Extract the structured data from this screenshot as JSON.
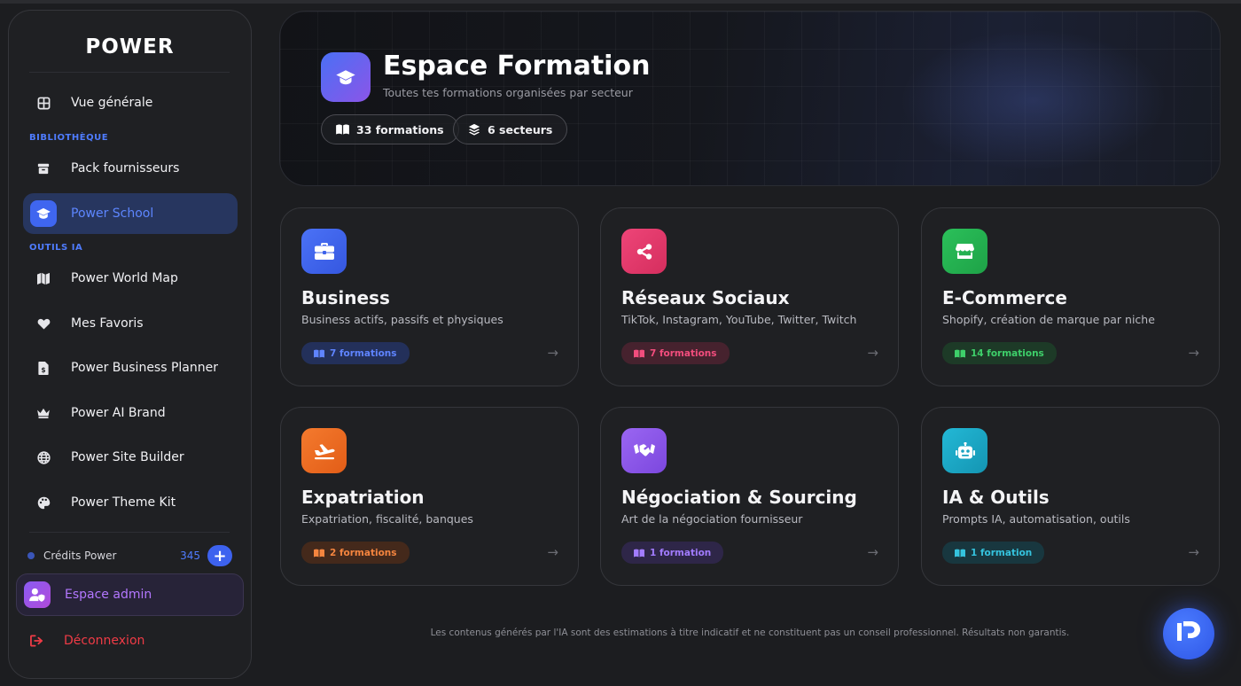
{
  "brand": {
    "logo_text": "POWER"
  },
  "sidebar": {
    "top_item": {
      "label": "Vue générale",
      "icon": "grid-icon"
    },
    "section_library": "BIBLIOTHÈQUE",
    "library_items": [
      {
        "label": "Pack fournisseurs",
        "icon": "box-icon"
      },
      {
        "label": "Power School",
        "icon": "graduation-cap-icon",
        "active": true
      }
    ],
    "section_tools": "OUTILS IA",
    "tool_items": [
      {
        "label": "Power World Map",
        "icon": "map-icon"
      },
      {
        "label": "Mes Favoris",
        "icon": "heart-icon"
      },
      {
        "label": "Power Business Planner",
        "icon": "document-dollar-icon"
      },
      {
        "label": "Power AI Brand",
        "icon": "crown-icon"
      },
      {
        "label": "Power Site Builder",
        "icon": "globe-icon"
      },
      {
        "label": "Power Theme Kit",
        "icon": "palette-icon"
      }
    ],
    "credits": {
      "label": "Crédits Power",
      "value": "345",
      "add_label": "+"
    },
    "admin": {
      "label": "Espace admin",
      "icon": "user-shield-icon"
    },
    "logout": {
      "label": "Déconnexion",
      "icon": "logout-icon"
    }
  },
  "hero": {
    "title": "Espace Formation",
    "subtitle": "Toutes tes formations organisées par secteur",
    "stats": [
      {
        "label": "33 formations",
        "icon": "book-icon"
      },
      {
        "label": "6 secteurs",
        "icon": "layers-icon"
      }
    ]
  },
  "sectors": [
    {
      "title": "Business",
      "subtitle": "Business actifs, passifs et physiques",
      "badge": "7 formations",
      "icon": "briefcase-icon",
      "color": "#3f63ec",
      "badge_bg": "#23305a",
      "badge_fg": "#5f84ff"
    },
    {
      "title": "Réseaux Sociaux",
      "subtitle": "TikTok, Instagram, YouTube, Twitter, Twitch",
      "badge": "7 formations",
      "icon": "share-icon",
      "color": "#e23a6b",
      "badge_bg": "#46222e",
      "badge_fg": "#f24d7d"
    },
    {
      "title": "E-Commerce",
      "subtitle": "Shopify, création de marque par niche",
      "badge": "14 formations",
      "icon": "store-icon",
      "color": "#22b14f",
      "badge_bg": "#1d3a27",
      "badge_fg": "#3ecf6a"
    },
    {
      "title": "Expatriation",
      "subtitle": "Expatriation, fiscalité, banques",
      "badge": "2 formations",
      "icon": "plane-icon",
      "color": "#ec6a22",
      "badge_bg": "#44291b",
      "badge_fg": "#f5853f"
    },
    {
      "title": "Négociation & Sourcing",
      "subtitle": "Art de la négociation fournisseur",
      "badge": "1 formation",
      "icon": "handshake-icon",
      "color": "#8a55ea",
      "badge_bg": "#2e2648",
      "badge_fg": "#a27cff"
    },
    {
      "title": "IA & Outils",
      "subtitle": "Prompts IA, automatisation, outils",
      "badge": "1 formation",
      "icon": "robot-icon",
      "color": "#1aa7c4",
      "badge_bg": "#18373f",
      "badge_fg": "#35c3de"
    }
  ],
  "footer": {
    "disclaimer": "Les contenus générés par l'IA sont des estimations à titre indicatif et ne constituent pas un conseil professionnel. Résultats non garantis."
  },
  "fab": {
    "icon": "power-logo-icon"
  }
}
